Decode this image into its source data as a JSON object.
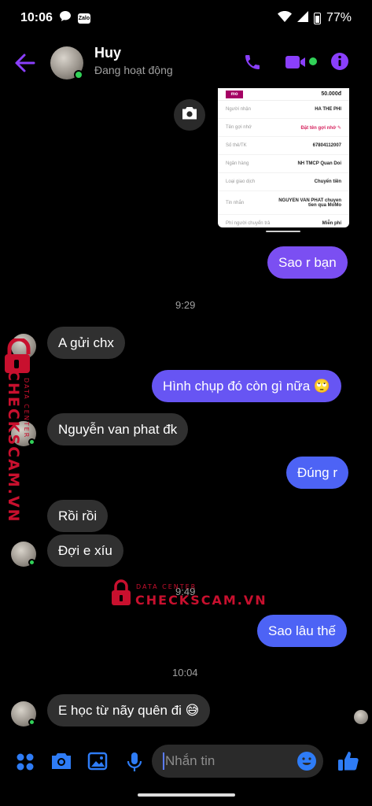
{
  "status_bar": {
    "time": "10:06",
    "app_badge": "Zalo",
    "battery": "77%"
  },
  "header": {
    "name": "Huy",
    "status": "Đang hoạt động"
  },
  "receipt": {
    "logo": "mo",
    "amount": "50.000đ",
    "rows": [
      {
        "label": "Người nhận",
        "value": "HA THE PHI"
      },
      {
        "label": "Tên gợi nhớ",
        "value": "Đặt tên gợi nhớ ✎"
      },
      {
        "label": "Số thẻ/TK",
        "value": "67804112007"
      },
      {
        "label": "Ngân hàng",
        "value": "NH TMCP Quan Doi"
      },
      {
        "label": "Loại giao dịch",
        "value": "Chuyển tiền"
      },
      {
        "label": "Tin nhắn",
        "value": "NGUYEN VAN PHAT chuyen tien qua MoMo"
      },
      {
        "label": "Phí người chuyển trả",
        "value": "Miễn phí"
      }
    ]
  },
  "messages": {
    "m1": "Sao r bạn",
    "t1": "9:29",
    "m2": "A gửi chx",
    "m3": "Hình chụp đó còn gì nữa 🙄",
    "m4": "Nguyễn van phat đk",
    "m5": "Đúng r",
    "m6": "Rồi rồi",
    "m7": "Đợi e xíu",
    "t2": "9:49",
    "m8": "Sao lâu thế",
    "t3": "10:04",
    "m9": "E học từ nãy quên đi 😅"
  },
  "watermark": {
    "brand": "CHECKSCAM.VN",
    "sub": "DATA CENTER"
  },
  "composer": {
    "placeholder": "Nhắn tin"
  },
  "colors": {
    "accent": "#8a3ffc",
    "bubble_purple": "#7b4ff2",
    "bubble_blue": "#4d63f5",
    "bubble_in": "#303030",
    "online": "#31d158"
  }
}
